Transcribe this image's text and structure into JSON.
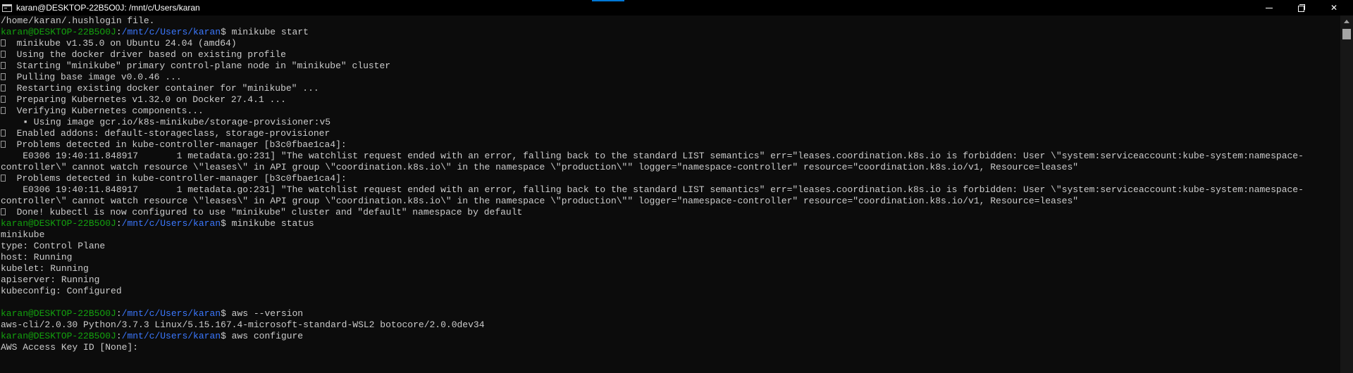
{
  "window": {
    "title": "karan@DESKTOP-22B5O0J: /mnt/c/Users/karan",
    "icon": "terminal-icon",
    "controls": {
      "minimize": "minimize-icon",
      "maximize": "restore-icon",
      "close": "close-icon"
    }
  },
  "colors": {
    "background": "#0c0c0c",
    "text": "#cccccc",
    "prompt_user": "#13a10e",
    "prompt_path": "#3b78ff",
    "accent": "#0078d7"
  },
  "terminal": {
    "lines": [
      {
        "type": "text",
        "text": "/home/karan/.hushlogin file."
      },
      {
        "type": "prompt",
        "user": "karan@DESKTOP-22B5O0J",
        "sep": ":",
        "path": "/mnt/c/Users/karan",
        "cmd": "$ minikube start"
      },
      {
        "type": "glyph",
        "text": "  minikube v1.35.0 on Ubuntu 24.04 (amd64)"
      },
      {
        "type": "glyph",
        "text": "  Using the docker driver based on existing profile"
      },
      {
        "type": "glyph",
        "text": "  Starting \"minikube\" primary control-plane node in \"minikube\" cluster"
      },
      {
        "type": "glyph",
        "text": "  Pulling base image v0.0.46 ..."
      },
      {
        "type": "glyph",
        "text": "  Restarting existing docker container for \"minikube\" ..."
      },
      {
        "type": "glyph",
        "text": "  Preparing Kubernetes v1.32.0 on Docker 27.4.1 ..."
      },
      {
        "type": "glyph",
        "text": "  Verifying Kubernetes components..."
      },
      {
        "type": "text",
        "text": "    ▪ Using image gcr.io/k8s-minikube/storage-provisioner:v5"
      },
      {
        "type": "glyph",
        "text": "  Enabled addons: default-storageclass, storage-provisioner"
      },
      {
        "type": "glyph",
        "text": "  Problems detected in kube-controller-manager [b3c0fbae1ca4]:"
      },
      {
        "type": "text",
        "text": "    E0306 19:40:11.848917       1 metadata.go:231] \"The watchlist request ended with an error, falling back to the standard LIST semantics\" err=\"leases.coordination.k8s.io is forbidden: User \\\"system:serviceaccount:kube-system:namespace-"
      },
      {
        "type": "text",
        "text": "controller\\\" cannot watch resource \\\"leases\\\" in API group \\\"coordination.k8s.io\\\" in the namespace \\\"production\\\"\" logger=\"namespace-controller\" resource=\"coordination.k8s.io/v1, Resource=leases\""
      },
      {
        "type": "glyph",
        "text": "  Problems detected in kube-controller-manager [b3c0fbae1ca4]:"
      },
      {
        "type": "text",
        "text": "    E0306 19:40:11.848917       1 metadata.go:231] \"The watchlist request ended with an error, falling back to the standard LIST semantics\" err=\"leases.coordination.k8s.io is forbidden: User \\\"system:serviceaccount:kube-system:namespace-"
      },
      {
        "type": "text",
        "text": "controller\\\" cannot watch resource \\\"leases\\\" in API group \\\"coordination.k8s.io\\\" in the namespace \\\"production\\\"\" logger=\"namespace-controller\" resource=\"coordination.k8s.io/v1, Resource=leases\""
      },
      {
        "type": "glyph",
        "text": "  Done! kubectl is now configured to use \"minikube\" cluster and \"default\" namespace by default"
      },
      {
        "type": "prompt",
        "user": "karan@DESKTOP-22B5O0J",
        "sep": ":",
        "path": "/mnt/c/Users/karan",
        "cmd": "$ minikube status"
      },
      {
        "type": "text",
        "text": "minikube"
      },
      {
        "type": "text",
        "text": "type: Control Plane"
      },
      {
        "type": "text",
        "text": "host: Running"
      },
      {
        "type": "text",
        "text": "kubelet: Running"
      },
      {
        "type": "text",
        "text": "apiserver: Running"
      },
      {
        "type": "text",
        "text": "kubeconfig: Configured"
      },
      {
        "type": "text",
        "text": ""
      },
      {
        "type": "prompt",
        "user": "karan@DESKTOP-22B5O0J",
        "sep": ":",
        "path": "/mnt/c/Users/karan",
        "cmd": "$ aws --version"
      },
      {
        "type": "text",
        "text": "aws-cli/2.0.30 Python/3.7.3 Linux/5.15.167.4-microsoft-standard-WSL2 botocore/2.0.0dev34"
      },
      {
        "type": "prompt",
        "user": "karan@DESKTOP-22B5O0J",
        "sep": ":",
        "path": "/mnt/c/Users/karan",
        "cmd": "$ aws configure"
      },
      {
        "type": "text",
        "text": "AWS Access Key ID [None]:"
      }
    ]
  }
}
